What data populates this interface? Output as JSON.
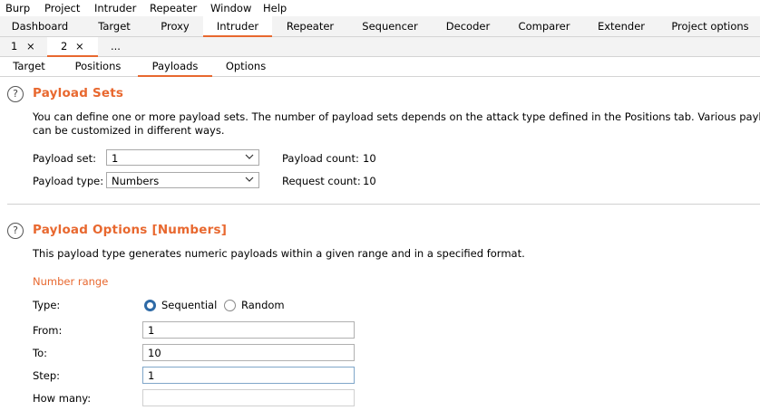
{
  "menubar": [
    "Burp",
    "Project",
    "Intruder",
    "Repeater",
    "Window",
    "Help"
  ],
  "main_tabs": [
    "Dashboard",
    "Target",
    "Proxy",
    "Intruder",
    "Repeater",
    "Sequencer",
    "Decoder",
    "Comparer",
    "Extender",
    "Project options"
  ],
  "active_main_tab": "Intruder",
  "attack_tabs": [
    {
      "label": "1",
      "close": "×"
    },
    {
      "label": "2",
      "close": "×"
    },
    {
      "label": "...",
      "close": ""
    }
  ],
  "sub_tabs": [
    "Target",
    "Positions",
    "Payloads",
    "Options"
  ],
  "active_sub_tab": "Payloads",
  "payload_sets": {
    "help": "?",
    "title": "Payload Sets",
    "description_line1": "You can define one or more payload sets. The number of payload sets depends on the attack type defined in the Positions tab. Various payload",
    "description_line2": "can be customized in different ways.",
    "set_label": "Payload set:",
    "set_value": "1",
    "type_label": "Payload type:",
    "type_value": "Numbers",
    "payload_count_label": "Payload count:",
    "payload_count_value": "10",
    "request_count_label": "Request count:",
    "request_count_value": "10"
  },
  "payload_options": {
    "help": "?",
    "title": "Payload Options [Numbers]",
    "description": "This payload type generates numeric payloads within a given range and in a specified format.",
    "section_label": "Number range",
    "type_label": "Type:",
    "radio_sequential": "Sequential",
    "radio_random": "Random",
    "selected_type": "Sequential",
    "from_label": "From:",
    "from_value": "1",
    "to_label": "To:",
    "to_value": "10",
    "step_label": "Step:",
    "step_value": "1",
    "how_many_label": "How many:",
    "how_many_value": ""
  },
  "colors": {
    "accent": "#e8682f",
    "radio": "#2e6aa6"
  }
}
